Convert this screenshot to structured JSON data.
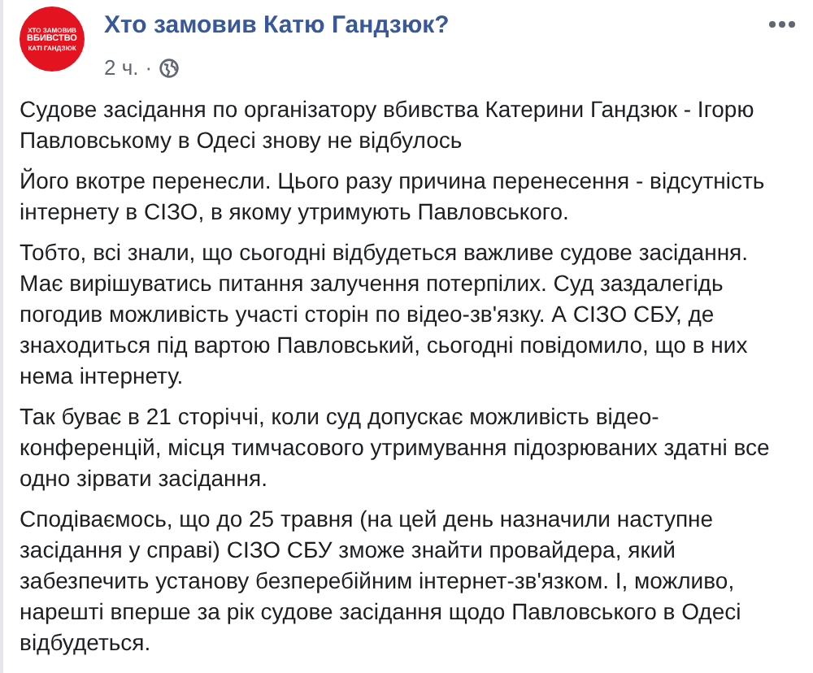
{
  "post": {
    "author": "Хто замовив Катю Гандзюк?",
    "avatar_lines": [
      "ХТО ЗАМОВИВ",
      "ВБИВСТВО",
      "КАТІ ГАНДЗЮК"
    ],
    "time": "2 ч.",
    "separator": "·",
    "paragraphs": [
      "Судове засідання по організатору вбивства Катерини Гандзюк - Ігорю Павловському в Одесі знову не відбулось",
      "Його вкотре перенесли. Цього разу причина перенесення - відсутність інтернету в СІЗО, в якому утримують Павловського.",
      "Тобто, всі знали, що сьогодні відбудеться важливе судове засідання. Має вирішуватись питання залучення потерпілих. Суд заздалегідь погодив можливість участі сторін по відео-зв'язку. А СІЗО СБУ, де знаходиться під вартою Павловський, сьогодні повідомило, що в них нема інтернету.",
      "Так буває в 21 сторіччі, коли суд допускає можливість відео-конференцій, місця тимчасового утримування підозрюваних здатні все одно зірвати засідання.",
      "Сподіваємось, що до 25 травня (на цей день назначили наступне засідання у справі) СІЗО СБУ зможе знайти провайдера, який забезпечить установу безперебійним інтернет-зв'язком. І, можливо, нарешті вперше за рік судове засідання щодо Павловського в Одесі відбудеться."
    ]
  }
}
